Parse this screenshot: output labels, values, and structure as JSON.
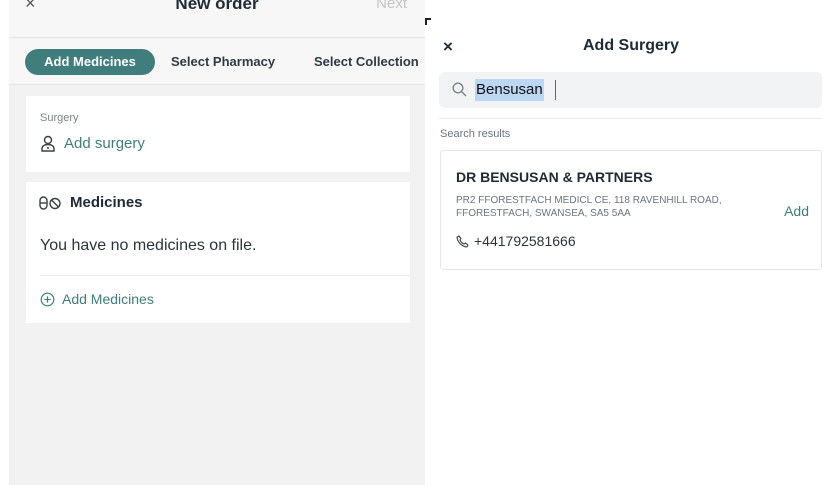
{
  "left": {
    "header": {
      "close_glyph": "×",
      "title": "New order",
      "next_label": "Next"
    },
    "tabs": [
      {
        "label": "Add Medicines",
        "active": true
      },
      {
        "label": "Select Pharmacy",
        "active": false
      },
      {
        "label": "Select Collection",
        "active": false
      }
    ],
    "surgery_card": {
      "label": "Surgery",
      "action_label": "Add surgery",
      "icon": "doctor-icon"
    },
    "medicines_card": {
      "title": "Medicines",
      "icon": "pills-icon",
      "empty_text": "You have no medicines on file.",
      "action_label": "Add Medicines",
      "action_icon": "plus-circle-icon"
    }
  },
  "right": {
    "header": {
      "close_glyph": "×",
      "title": "Add Surgery"
    },
    "search": {
      "query": "Bensusan",
      "icon": "search-icon"
    },
    "results_label": "Search results",
    "results": [
      {
        "name": "DR BENSUSAN & PARTNERS",
        "address": "PR2 FFORESTFACH MEDICL CE, 118 RAVENHILL ROAD, FFORESTFACH, SWANSEA, SA5 5AA",
        "phone": "+441792581666",
        "add_label": "Add"
      }
    ]
  },
  "colors": {
    "accent": "#3f7e7c",
    "background": "#f2f2f2",
    "text": "#1f2a37"
  }
}
